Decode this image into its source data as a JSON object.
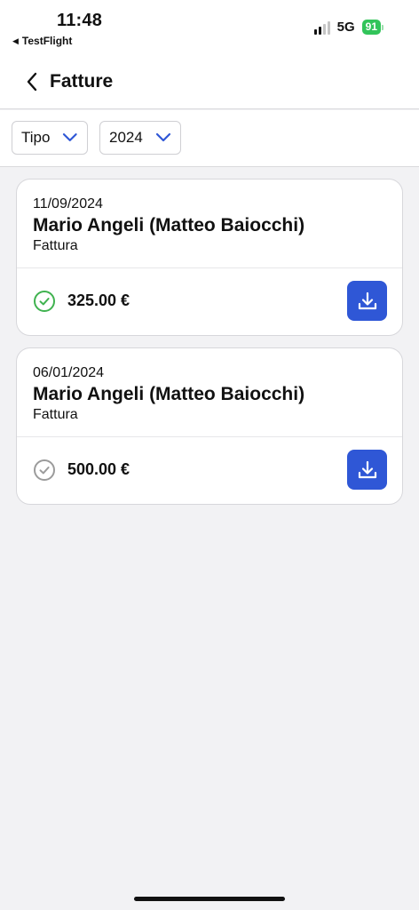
{
  "status_bar": {
    "time": "11:48",
    "back_app": "TestFlight",
    "network": "5G",
    "battery": "91"
  },
  "navbar": {
    "title": "Fatture"
  },
  "filters": {
    "type_label": "Tipo",
    "year_label": "2024"
  },
  "invoices": [
    {
      "date": "11/09/2024",
      "name": "Mario Angeli (Matteo Baiocchi)",
      "type": "Fattura",
      "amount": "325.00 €",
      "status_icon": "check-circle-green"
    },
    {
      "date": "06/01/2024",
      "name": "Mario Angeli (Matteo Baiocchi)",
      "type": "Fattura",
      "amount": "500.00 €",
      "status_icon": "check-circle-gray"
    }
  ],
  "colors": {
    "accent": "#2f57d6",
    "success": "#3fb24f",
    "muted": "#9b9b9b",
    "battery": "#32c45a"
  }
}
